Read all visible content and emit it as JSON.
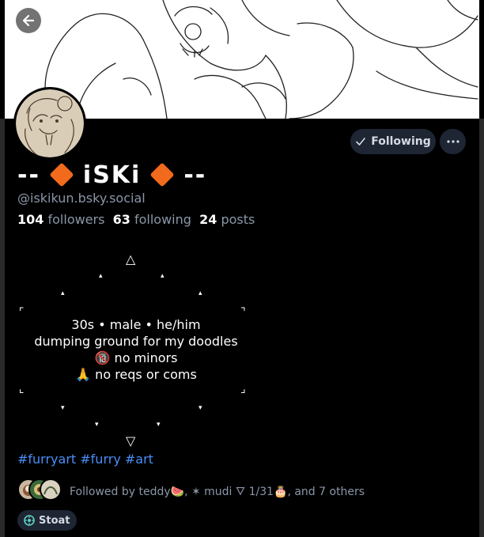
{
  "header": {
    "back_icon": "arrow-left-icon"
  },
  "profile": {
    "display_name_left": "--",
    "display_name_core": "iSKi",
    "display_name_right": "--",
    "handle": "@iskikun.bsky.social",
    "stats": {
      "followers_count": "104",
      "followers_label": "followers",
      "following_count": "63",
      "following_label": "following",
      "posts_count": "24",
      "posts_label": "posts"
    }
  },
  "actions": {
    "following_label": "Following",
    "following_icon": "check-icon",
    "more_icon": "ellipsis-icon"
  },
  "bio": {
    "deco_top": "△",
    "deco_bottom": "▽",
    "deco_small_up": "▴",
    "deco_small_down": "▾",
    "corner_tl": "⌜",
    "corner_tr": "⌝",
    "corner_bl": "⌞",
    "corner_br": "⌟",
    "line1": "30s • male • he/him",
    "line2": "dumping ground for my doodles",
    "line3": "🔞 no minors",
    "line4": "🙏 no reqs or coms"
  },
  "hashtags": "#furryart #furry #art",
  "followed_by": {
    "text": "Followed by teddy🍉, ✶ mudi 🜄 1/31🎂, and 7 others"
  },
  "chip": {
    "label": "Stoat",
    "icon": "stoat-app-icon"
  },
  "colors": {
    "accent_orange": "#f26a1b",
    "link_blue": "#4a8df8",
    "muted_text": "#8b96a8",
    "button_bg": "#1e2533"
  }
}
